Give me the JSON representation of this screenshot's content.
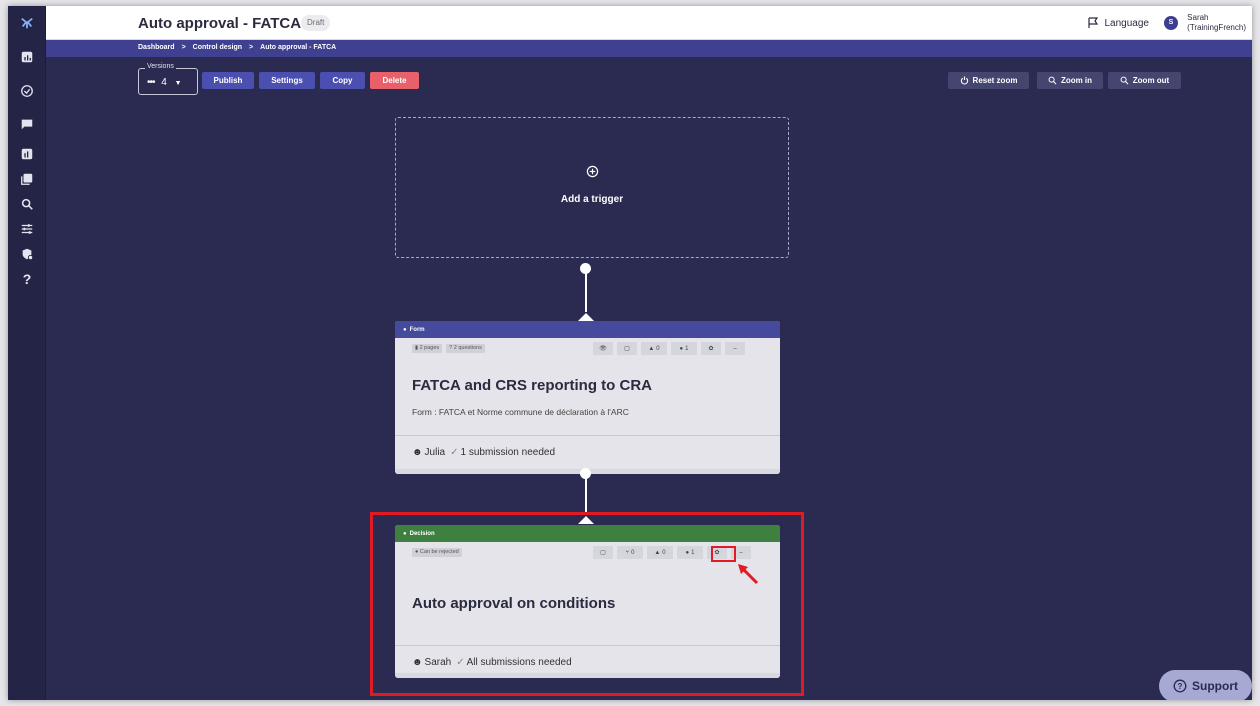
{
  "app": {
    "title": "Auto approval - FATCA",
    "status_badge": "Draft"
  },
  "header": {
    "language_label": "Language",
    "user_initial": "S",
    "user_name": "Sarah",
    "user_role": "(TrainingFrench)"
  },
  "breadcrumb": {
    "items": [
      "Dashboard",
      "Control design",
      "Auto approval - FATCA"
    ],
    "separator": ">"
  },
  "toolbar": {
    "versions_label": "Versions",
    "versions_value": "4",
    "publish": "Publish",
    "settings": "Settings",
    "copy": "Copy",
    "delete": "Delete",
    "reset_zoom": "Reset zoom",
    "zoom_in": "Zoom in",
    "zoom_out": "Zoom out"
  },
  "trigger": {
    "label": "Add a trigger"
  },
  "form_card": {
    "type_label": "Form",
    "tags": [
      "2 pages",
      "2 questions"
    ],
    "notifications_count": "0",
    "users_count": "1",
    "title": "FATCA and CRS reporting to CRA",
    "subtitle": "Form : FATCA et Norme commune de déclaration à l'ARC",
    "assignee": "Julia",
    "requirement": "1 submission needed"
  },
  "decision_card": {
    "type_label": "Decision",
    "tags": [
      "Can be rejected"
    ],
    "branches_count": "0",
    "notifications_count": "0",
    "users_count": "1",
    "title": "Auto approval on conditions",
    "assignee": "Sarah",
    "requirement": "All submissions needed"
  },
  "support": {
    "label": "Support"
  },
  "colors": {
    "canvas": "#2b2b52",
    "brand_blue": "#4a4fb0",
    "danger": "#e8606a",
    "decision_green": "#3e8040",
    "highlight_red": "#e01b24"
  }
}
